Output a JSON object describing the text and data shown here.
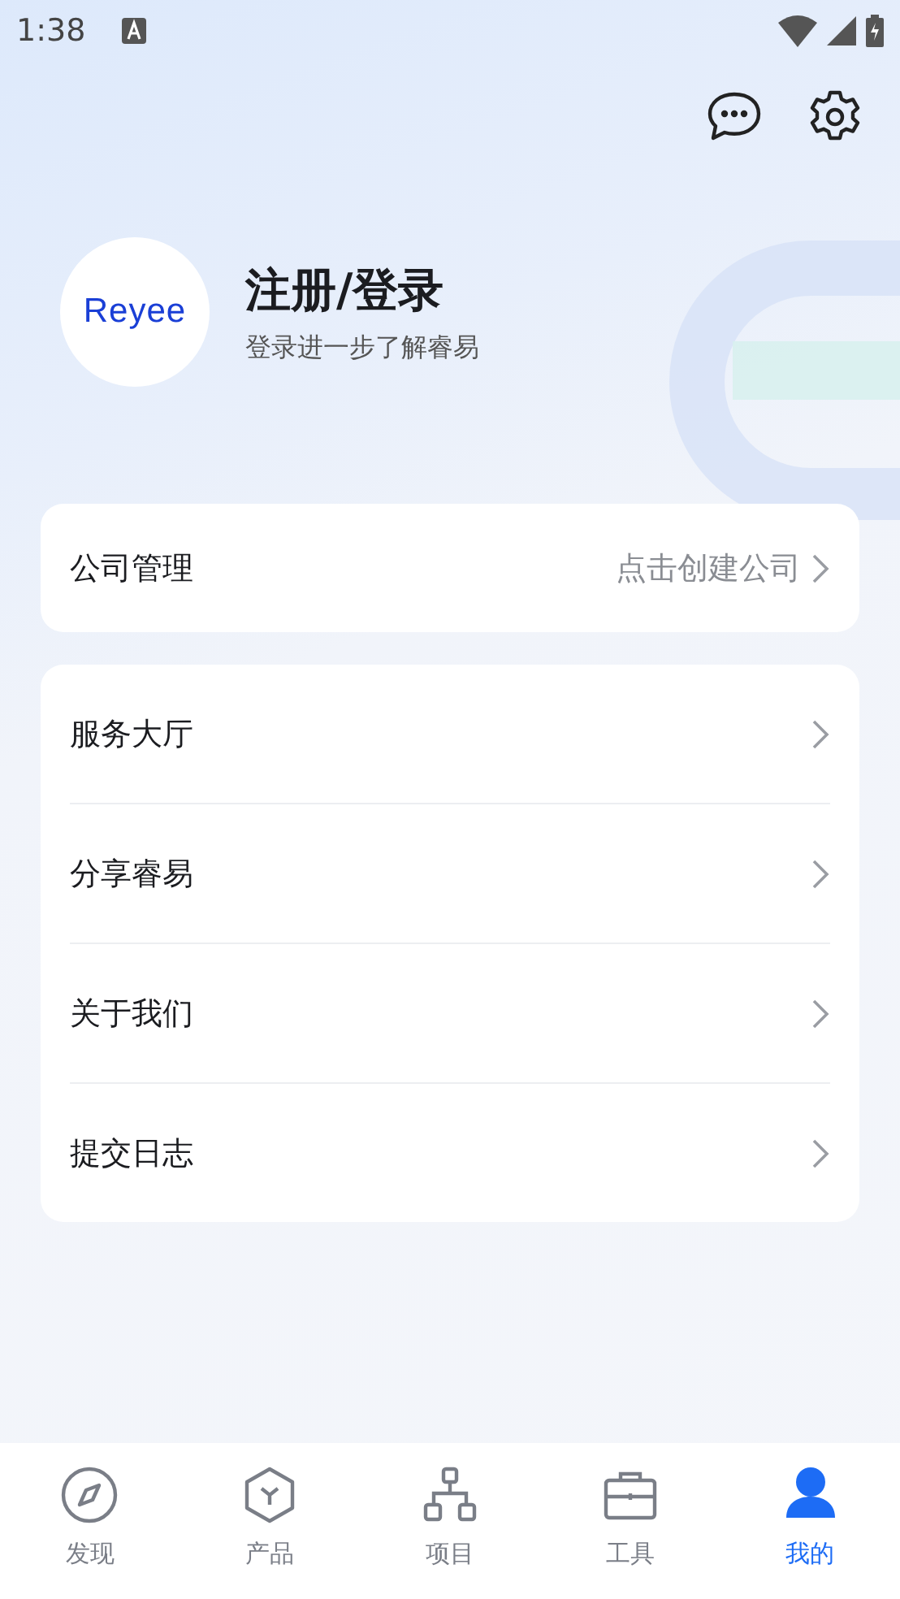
{
  "status_bar": {
    "time": "1:38"
  },
  "profile": {
    "logo": "Reyee",
    "title": "注册/登录",
    "subtitle": "登录进一步了解睿易"
  },
  "company": {
    "label": "公司管理",
    "value": "点击创建公司"
  },
  "menu": [
    {
      "label": "服务大厅"
    },
    {
      "label": "分享睿易"
    },
    {
      "label": "关于我们"
    },
    {
      "label": "提交日志"
    }
  ],
  "tabs": [
    {
      "kind": "compass",
      "label": "发现",
      "selected": false
    },
    {
      "kind": "cube",
      "label": "产品",
      "selected": false
    },
    {
      "kind": "tree",
      "label": "项目",
      "selected": false
    },
    {
      "kind": "toolbox",
      "label": "工具",
      "selected": false
    },
    {
      "kind": "person",
      "label": "我的",
      "selected": true
    }
  ]
}
